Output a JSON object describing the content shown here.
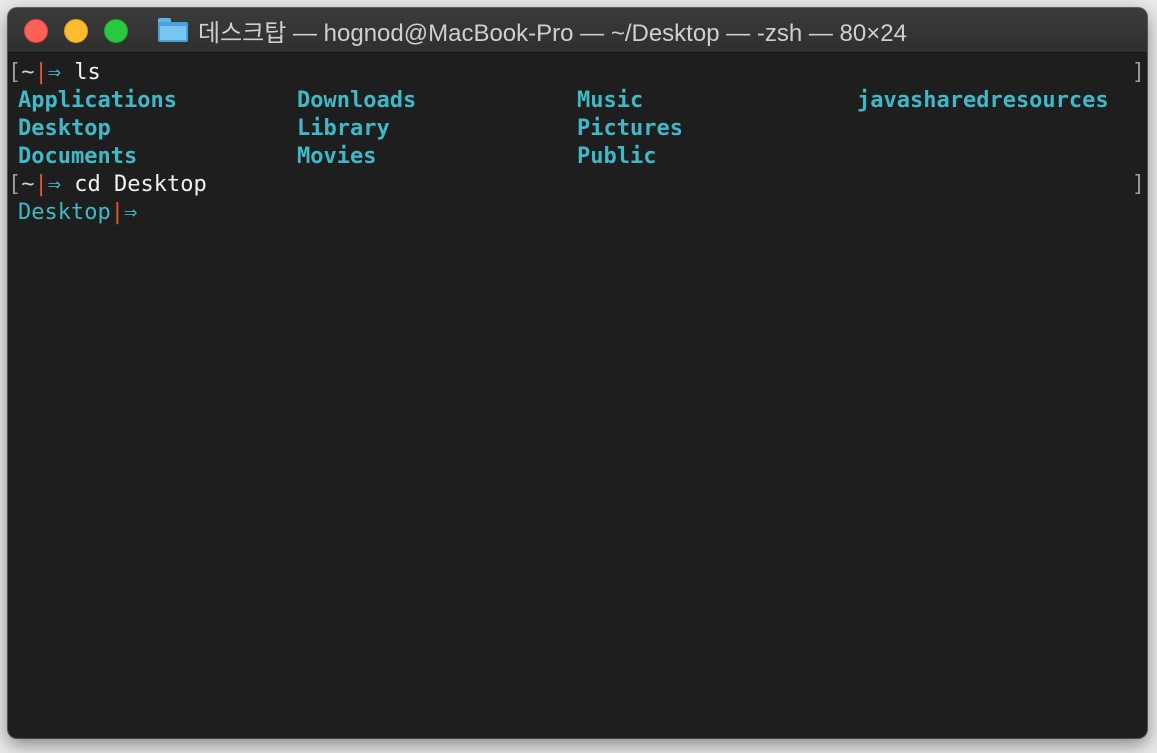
{
  "window": {
    "title": "데스크탑 — hognod@MacBook-Pro — ~/Desktop — -zsh — 80×24",
    "icon": "folder-icon"
  },
  "colors": {
    "background": "#1e1e1e",
    "directory": "#3fb8c8",
    "separator": "#e4572e",
    "command": "#f2f2f2"
  },
  "terminal": {
    "prompt1": {
      "open_bracket": "[",
      "dir": "~",
      "separator": "|",
      "arrow": "⇒",
      "command": " ls",
      "close_bracket": "]"
    },
    "ls_output": [
      [
        "Applications",
        "Downloads",
        "Music",
        "javasharedresources"
      ],
      [
        "Desktop",
        "Library",
        "Pictures",
        ""
      ],
      [
        "Documents",
        "Movies",
        "Public",
        ""
      ]
    ],
    "prompt2": {
      "open_bracket": "[",
      "dir": "~",
      "separator": "|",
      "arrow": "⇒",
      "command": " cd Desktop",
      "close_bracket": "]"
    },
    "prompt3": {
      "dir": "Desktop",
      "separator": "|",
      "arrow": "⇒"
    }
  }
}
